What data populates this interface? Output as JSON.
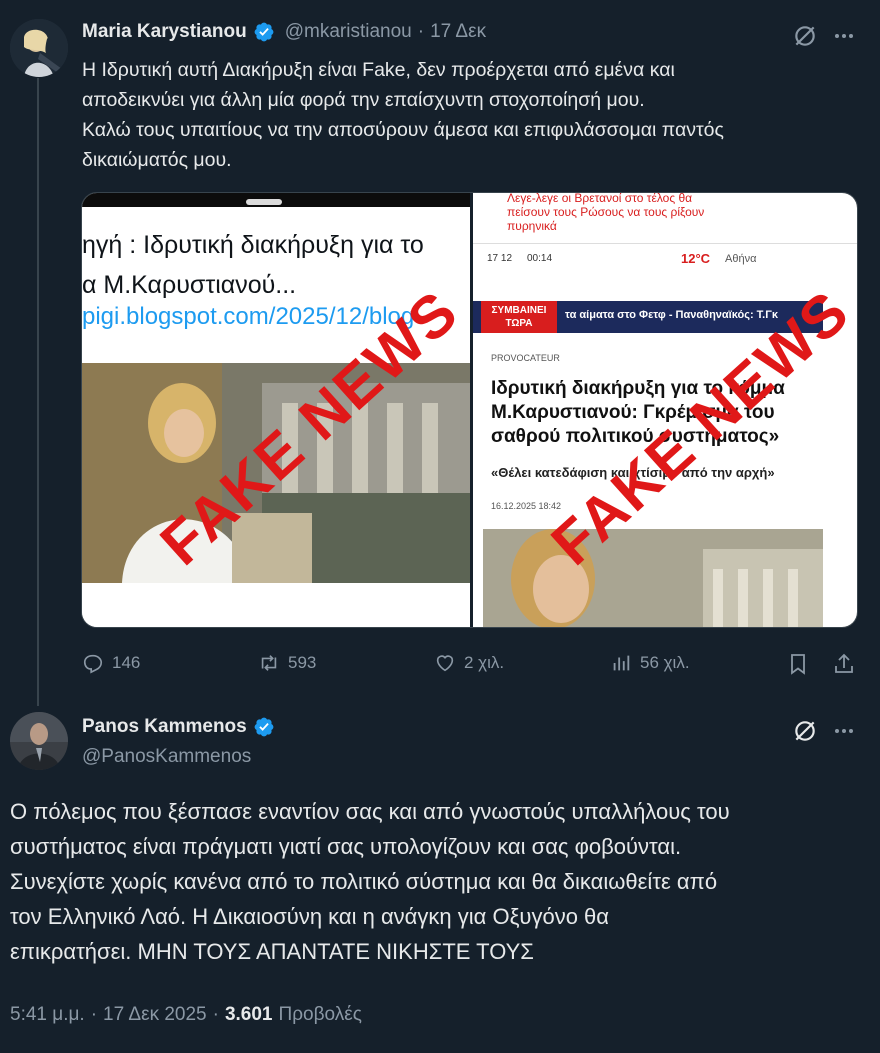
{
  "tweet1": {
    "author_name": "Maria Karystianou",
    "handle": "@mkaristianou",
    "separator": "·",
    "date": "17 Δεκ",
    "lines": [
      "Η Ιδρυτική αυτή Διακήρυξη είναι Fake, δεν προέρχεται από εμένα και",
      "αποδεικνύει για άλλη μία φορά την επαίσχυντη στοχοποίησή μου.",
      "Καλώ τους υπαιτίους να την αποσύρουν άμεσα και επιφυλάσσομαι παντός",
      "δικαιώματός μου."
    ],
    "media_left": {
      "headline1": "ηγή  : Ιδρυτική διακήρυξη για το",
      "headline2": "α Μ.Καρυστιανού...",
      "link": "pigi.blogspot.com/2025/12/blog-",
      "stamp": "FAKE NEWS"
    },
    "media_right": {
      "top_text1": "Λεγε-λεγε οι Βρετανοί στο τέλος θα",
      "top_text2": "πείσουν τους Ρώσους να τους ρίξουν",
      "top_text3": "πυρηνικά",
      "date": "17 12",
      "time": "00:14",
      "temp": "12°C",
      "city": "Αθήνα",
      "breaking_label1": "ΣΥΜΒΑΙΝΕΙ",
      "breaking_label2": "ΤΩΡΑ",
      "ticker": "τα αίματα στο Φετφ - Παναθηναϊκός: Τ.Γκ",
      "category": "PROVOCATEUR",
      "headline1": "Ιδρυτική διακήρυξη για το κόμμα",
      "headline2": "Μ.Καρυστιανού: Γκρέμισμα του",
      "headline3": "σαθρού πολιτικού συστήματος»",
      "subhead": "«Θέλει κατεδάφιση και χτίσιμο από την αρχή»",
      "timestamp": "16.12.2025 18:42",
      "stamp": "FAKE NEWS"
    },
    "actions": {
      "replies": "146",
      "reposts": "593",
      "likes": "2 χιλ.",
      "views": "56 χιλ."
    }
  },
  "tweet2": {
    "author_name": "Panos Kammenos",
    "handle": "@PanosKammenos",
    "lines": [
      "Ο πόλεμος που ξέσπασε εναντίον σας και από γνωστούς υπαλλήλους του",
      "συστήματος είναι πράγματι γιατί σας υπολογίζουν και σας φοβούνται.",
      "Συνεχίστε χωρίς κανένα από το πολιτικό σύστημα και θα δικαιωθείτε από",
      "τον Ελληνικό Λαό. Η Δικαιοσύνη και η ανάγκη για Οξυγόνο θα",
      "επικρατήσει. ΜΗΝ ΤΟΥΣ ΑΠΑΝΤΑΤΕ ΝΙΚΗΣΤΕ ΤΟΥΣ"
    ],
    "meta_time": "5:41 μ.μ.",
    "meta_dot1": "·",
    "meta_date": "17 Δεκ 2025",
    "meta_dot2": "·",
    "meta_views_count": "3.601",
    "meta_views_label": "Προβολές"
  },
  "colors": {
    "background": "#15202b",
    "verified": "#1d9bf0",
    "stamp": "#e01818",
    "muted": "#8b98a5"
  },
  "icons": [
    "verified-icon",
    "grok-icon",
    "more-icon",
    "reply-icon",
    "repost-icon",
    "like-icon",
    "views-icon",
    "bookmark-icon",
    "share-icon"
  ]
}
